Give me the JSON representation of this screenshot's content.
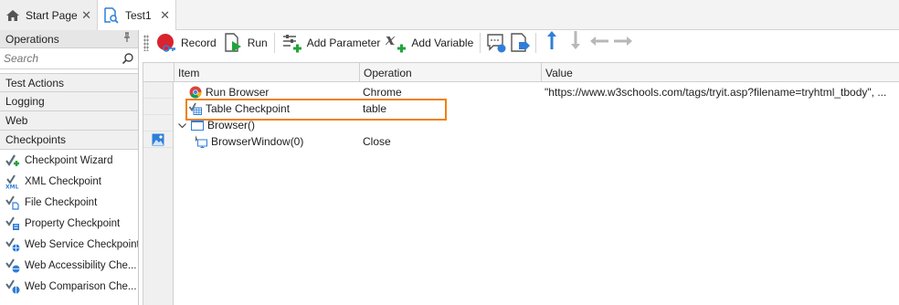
{
  "tabs": [
    {
      "label": "Start Page",
      "icon": "home-icon"
    },
    {
      "label": "Test1",
      "icon": "test-script-icon"
    }
  ],
  "operations_panel": {
    "title": "Operations",
    "search_placeholder": "Search",
    "categories": [
      "Test Actions",
      "Logging",
      "Web",
      "Checkpoints"
    ],
    "checkpoint_items": [
      "Checkpoint Wizard",
      "XML Checkpoint",
      "File Checkpoint",
      "Property Checkpoint",
      "Web Service Checkpoint",
      "Web Accessibility Che...",
      "Web Comparison Che..."
    ]
  },
  "toolbar": {
    "record_label": "Record",
    "run_label": "Run",
    "add_parameter_label": "Add Parameter",
    "add_variable_label": "Add Variable"
  },
  "grid": {
    "columns": [
      "Item",
      "Operation",
      "Value"
    ],
    "rows": [
      {
        "item": "Run Browser",
        "operation": "Chrome",
        "value": "\"https://www.w3schools.com/tags/tryit.asp?filename=tryhtml_tbody\", ..."
      },
      {
        "item": "Table Checkpoint",
        "operation": "table",
        "value": ""
      },
      {
        "item": "Browser()",
        "operation": "",
        "value": ""
      },
      {
        "item": "BrowserWindow(0)",
        "operation": "Close",
        "value": ""
      }
    ]
  },
  "colors": {
    "highlight": "#f0800c",
    "accent_blue": "#2f7ed8",
    "record_red": "#d9232d",
    "add_green": "#22a33b"
  }
}
